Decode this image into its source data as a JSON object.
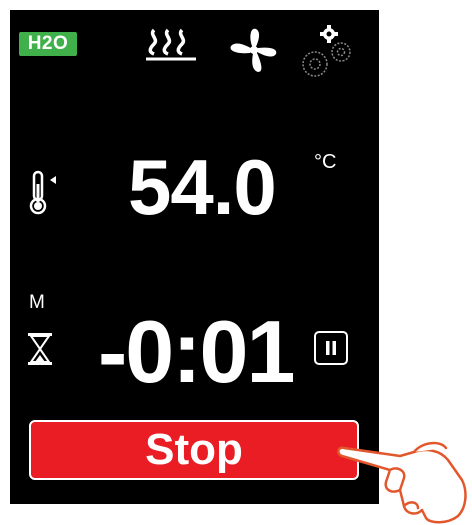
{
  "status_bar": {
    "water_badge": "H2O",
    "icons": [
      "heating-icon",
      "fan-icon",
      "settings-gears-icon"
    ]
  },
  "temperature": {
    "value": "54.0",
    "unit": "°C"
  },
  "timer": {
    "mode": "M",
    "value": "-0:01"
  },
  "stop_button": {
    "label": "Stop"
  },
  "colors": {
    "screen_background": "#000000",
    "water_badge": "#3fb04a",
    "stop_button": "#ea1c24",
    "text": "#ffffff",
    "hand_outline": "#e2572c"
  }
}
